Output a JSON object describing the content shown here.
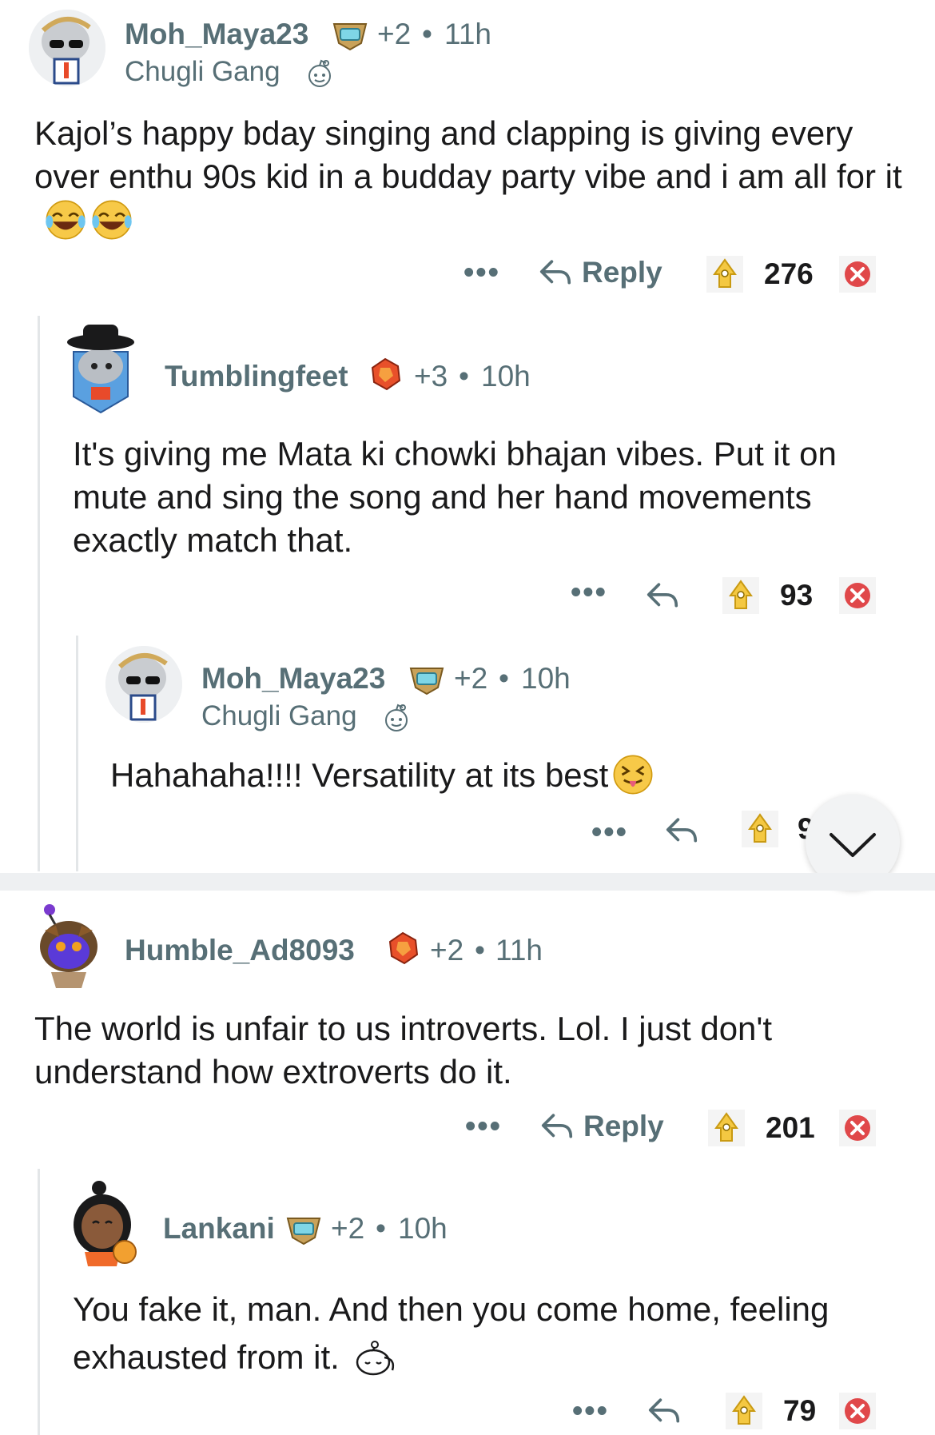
{
  "comments": [
    {
      "username": "Moh_Maya23",
      "award_count": "+2",
      "separator": "•",
      "time": "11h",
      "flair": "Chugli Gang",
      "text": "Kajol’s happy bday singing and clapping is giving every over enthu 90s kid in a budday party vibe and i am all for it",
      "reply_label": "Reply",
      "votes": "276",
      "more": "•••"
    },
    {
      "username": "Tumblingfeet",
      "award_count": "+3",
      "separator": "•",
      "time": "10h",
      "text": "It's giving me Mata ki chowki bhajan vibes. Put it on mute and sing the song and her hand movements exactly match that.",
      "votes": "93",
      "more": "•••"
    },
    {
      "username": "Moh_Maya23",
      "award_count": "+2",
      "separator": "•",
      "time": "10h",
      "flair": "Chugli Gang",
      "text": "Hahahaha!!!! Versatility at its best",
      "votes": "9",
      "more": "•••"
    },
    {
      "username": "Humble_Ad8093",
      "award_count": "+2",
      "separator": "•",
      "time": "11h",
      "text": "The world is unfair to us introverts. Lol. I just don't understand how extroverts do it.",
      "reply_label": "Reply",
      "votes": "201",
      "more": "•••"
    },
    {
      "username": "Lankani",
      "award_count": "+2",
      "separator": "•",
      "time": "10h",
      "text": "You fake it, man. And then you come home, feeling exhausted from it.",
      "votes": "79",
      "more": "•••"
    }
  ],
  "colors": {
    "meta_gray": "#576f76",
    "text": "#1a1a1b",
    "thread_line": "#e3e6e8",
    "upvote_gold": "#f0c23b",
    "downvote_red": "#e0484a"
  },
  "icons": [
    "reply-arrow-icon",
    "upvote-award-icon",
    "downvote-icon",
    "snoo-icon",
    "collapse-chevron-icon",
    "laughing-emoji-icon",
    "tongue-emoji-icon",
    "sleepy-snoo-icon"
  ]
}
